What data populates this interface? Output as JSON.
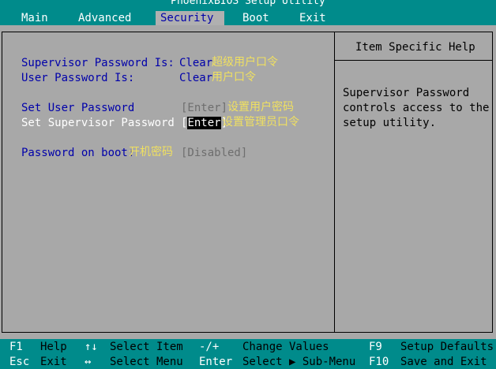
{
  "title": "PhoenixBIOS Setup Utility",
  "menu": [
    {
      "label": "Main"
    },
    {
      "label": "Advanced"
    },
    {
      "label": "Security"
    },
    {
      "label": "Boot"
    },
    {
      "label": "Exit"
    }
  ],
  "settings": {
    "supervisor_pw_status": {
      "label": "Supervisor Password Is:",
      "value": "Clear",
      "note": "超级用户口令"
    },
    "user_pw_status": {
      "label": "User Password Is:",
      "value": "Clear",
      "note": "用户口令"
    },
    "set_user_pw": {
      "label": "Set User Password",
      "value": "[Enter]",
      "note": "设置用户密码"
    },
    "set_supervisor_pw": {
      "label": "Set Supervisor Password",
      "bracket_open": "[",
      "value": "Enter",
      "bracket_close": "]",
      "note": "设置管理员口令"
    },
    "password_on_boot": {
      "label": "Password on boot:",
      "note": "开机密码",
      "value": "[Disabled]"
    }
  },
  "help": {
    "title": "Item Specific Help",
    "lines": [
      "Supervisor Password",
      "controls access to the",
      "setup utility."
    ]
  },
  "footer": {
    "f1": {
      "key": "F1",
      "label": "Help"
    },
    "esc": {
      "key": "Esc",
      "label": "Exit"
    },
    "updown": {
      "key": "↑↓",
      "label": "Select Item"
    },
    "leftright": {
      "key": "↔",
      "label": "Select Menu"
    },
    "plusminus": {
      "key": "-/+",
      "label": "Change Values"
    },
    "enter": {
      "key": "Enter",
      "label": "Select ▶ Sub-Menu"
    },
    "f9": {
      "key": "F9",
      "label": "Setup Defaults"
    },
    "f10": {
      "key": "F10",
      "label": "Save and Exit"
    }
  }
}
